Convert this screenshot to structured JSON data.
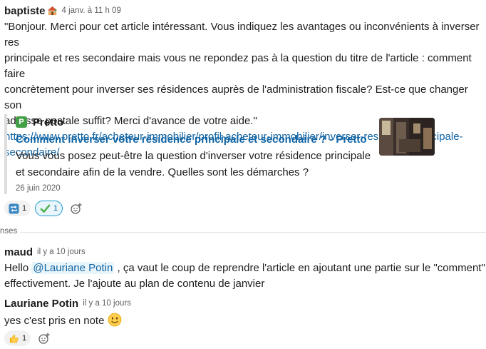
{
  "messages": [
    {
      "author": "baptiste",
      "author_icon": "house-icon",
      "timestamp": "4 janv. à 11 h 09",
      "text_lines": [
        "\"Bonjour. Merci pour cet article intéressant. Vous indiquez les avantages ou inconvénients à inverser res",
        "principale et res secondaire mais vous ne repondez pas à la question du titre de l'article : comment faire",
        "concrètement pour inverser ses résidences auprès de l'administration fiscale? Est-ce que changer son",
        "adresse postale suffit? Merci d'avance de votre aide.\""
      ],
      "link_lines": [
        "https://www.pretto.fr/acheteur-immobilier/profil-acheteur-immobilier/inverser-residence-principale-",
        "secondaire/"
      ],
      "unfurl": {
        "source_badge": "P",
        "source_name": "Pretto",
        "title": "Comment inverser votre résidence principale et secondaire ? - Pretto",
        "description_lines": [
          "Vous vous posez peut-être la question d'inverser votre résidence principale",
          "et secondaire afin de la vendre. Quelles sont les démarches ?"
        ],
        "date": "26 juin 2020"
      },
      "reactions": [
        {
          "icon": "repeat-icon",
          "count": "1",
          "active": false
        },
        {
          "icon": "check-mark-icon",
          "count": "1",
          "active": true
        }
      ]
    },
    {
      "author": "maud",
      "timestamp": "il y a 10 jours",
      "text_before": "Hello ",
      "mention": "@Lauriane Potin",
      "text_after": " , ça vaut le coup de reprendre l'article en ajoutant une partie sur le \"comment\"",
      "text_line2": "effectivement. Je l'ajoute au plan de contenu de janvier"
    },
    {
      "author": "Lauriane Potin",
      "timestamp": "il y a 10 jours",
      "text": "yes c'est pris en note",
      "emoji": "slightly-smiling-face-icon",
      "reactions": [
        {
          "icon": "thumbs-up-icon",
          "count": "1",
          "active": false
        }
      ]
    }
  ],
  "divider_label": "nses",
  "colors": {
    "link": "#1264a3",
    "active_reaction_border": "#1d9bd1",
    "active_reaction_bg": "#e8f5fa",
    "check_green": "#4caf50"
  }
}
